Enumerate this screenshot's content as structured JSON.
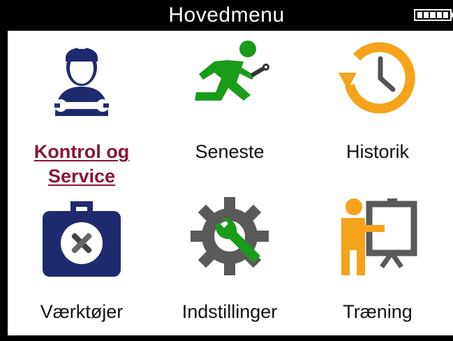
{
  "header": {
    "title": "Hovedmenu",
    "battery_icon": "battery-full-icon"
  },
  "menu": {
    "items": [
      {
        "label": "Kontrol og Service",
        "icon": "mechanic-icon",
        "selected": true,
        "color": "#1f2a6e"
      },
      {
        "label": "Seneste",
        "icon": "running-man-wrench-icon",
        "selected": false,
        "color": "#1a9b1a"
      },
      {
        "label": "Historik",
        "icon": "history-clock-icon",
        "selected": false,
        "color": "#f5a31a"
      },
      {
        "label": "Værktøjer",
        "icon": "toolbox-icon",
        "selected": false,
        "color": "#1f2a6e"
      },
      {
        "label": "Indstillinger",
        "icon": "gear-wrench-icon",
        "selected": false,
        "color": "#5a5a5a"
      },
      {
        "label": "Træning",
        "icon": "presenter-board-icon",
        "selected": false,
        "color": "#f5a31a"
      }
    ]
  },
  "colors": {
    "selected_label": "#8a1538",
    "navy": "#1f2a6e",
    "green": "#1a9b1a",
    "orange": "#f5a31a",
    "gray": "#5a5a5a"
  }
}
